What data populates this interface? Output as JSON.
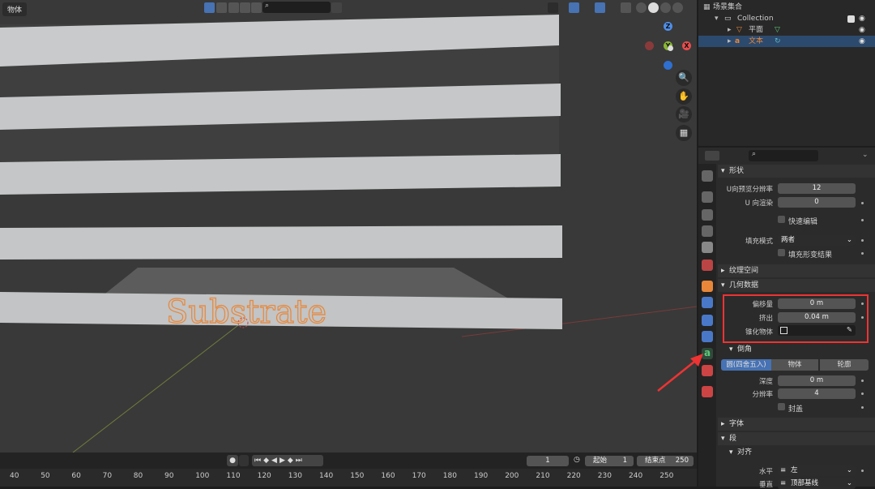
{
  "viewport": {
    "mode_tab": "物体",
    "scene_text": "Substrate",
    "gizmo": {
      "z": "Z",
      "y": "Y",
      "x": "X"
    }
  },
  "header": {
    "icons": [
      "select-box-icon",
      "shading-icon",
      "eye-icon",
      "filter-icon",
      "camera-icon",
      "search-icon",
      "overlay-icon",
      "gizmo-icon",
      "wireframe-icon",
      "solid-icon",
      "material-icon",
      "rendered-icon"
    ]
  },
  "nav": {
    "zoom": "🔍",
    "pan": "✋",
    "camera": "🎥",
    "grid": "▦"
  },
  "outliner": {
    "root": "场景集合",
    "collection": "Collection",
    "items": [
      "平面",
      "文本"
    ],
    "colors": {
      "mesh": "#e8873a",
      "text": "#5fb7c8",
      "selected_row": "#2c4a6e"
    }
  },
  "properties": {
    "shape": {
      "title": "形状",
      "u_preview_label": "U向预览分辨率",
      "u_preview_value": "12",
      "u_render_label": "U 向渲染",
      "u_render_value": "0",
      "fast_edit": "快速编辑",
      "fill_mode_label": "填充模式",
      "fill_mode_value": "两者",
      "fill_deform": "填充形变结果"
    },
    "texture_space": "纹理空间",
    "geometry": {
      "title": "几何数据",
      "offset_label": "偏移量",
      "offset_value": "0 m",
      "extrude_label": "挤出",
      "extrude_value": "0.04 m",
      "taper_label": "锥化物体"
    },
    "bevel": {
      "title": "倒角",
      "modes": [
        "圆(四舍五入)",
        "物体",
        "轮廓"
      ],
      "depth_label": "深度",
      "depth_value": "0 m",
      "res_label": "分辨率",
      "res_value": "4",
      "cap": "封盖"
    },
    "font": "字体",
    "paragraph": {
      "title": "段",
      "align_title": "对齐",
      "h_label": "水平",
      "h_value": "左",
      "v_label": "垂直",
      "v_value": "顶部基线"
    }
  },
  "timeline": {
    "current_frame": "1",
    "start_label": "起始",
    "start_value": "1",
    "end_label": "结束点",
    "end_value": "250",
    "ticks": [
      "40",
      "50",
      "60",
      "70",
      "80",
      "90",
      "100",
      "110",
      "120",
      "130",
      "140",
      "150",
      "160",
      "170",
      "180",
      "190",
      "200",
      "210",
      "220",
      "230",
      "240",
      "250"
    ]
  },
  "accent": "#e33",
  "highlight_color": "#4772b3"
}
